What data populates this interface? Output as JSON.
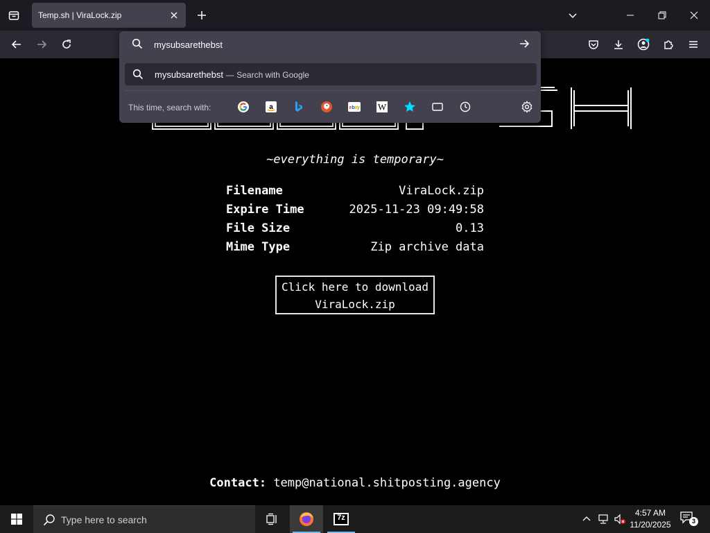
{
  "tab": {
    "title": "Temp.sh | ViraLock.zip"
  },
  "urlbar": {
    "value": "mysubsarethebst",
    "suggestion": {
      "query": "mysubsarethebst",
      "separator": "—",
      "action": "Search with Google"
    },
    "oneoff_label": "This time, search with:",
    "oneoff_engines": [
      "google",
      "amazon",
      "bing",
      "duckduckgo",
      "ebay",
      "wikipedia",
      "bookmarks-star",
      "tabs",
      "history"
    ]
  },
  "page": {
    "logo_text": "TEMP.SH",
    "tagline": "~everything is temporary~",
    "info": [
      {
        "key": "Filename",
        "value": "ViraLock.zip"
      },
      {
        "key": "Expire Time",
        "value": "2025-11-23 09:49:58"
      },
      {
        "key": "File Size",
        "value": "0.13"
      },
      {
        "key": "Mime Type",
        "value": "Zip archive data"
      }
    ],
    "download": {
      "line1": "Click here to download",
      "line2": "ViraLock.zip"
    },
    "contact": {
      "label": "Contact:",
      "email": "temp@national.shitposting.agency"
    }
  },
  "taskbar": {
    "search_placeholder": "Type here to search",
    "apps": [
      "task-view",
      "firefox",
      "7-zip"
    ],
    "seven_zip_label": "7z",
    "time": "4:57 AM",
    "date": "11/20/2025",
    "notification_count": "3"
  },
  "colors": {
    "chrome_dark": "#1c1b22",
    "chrome_toolbar": "#2b2a33",
    "popup": "#42414d",
    "accent": "#76b9ed"
  }
}
